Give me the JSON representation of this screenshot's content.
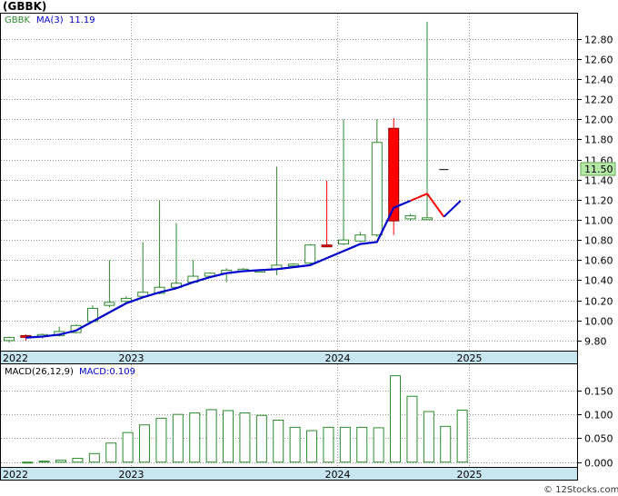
{
  "title": "(GBBK)",
  "watermark": "© 12Stocks.com",
  "price_panel": {
    "legend_symbol": "GBBK",
    "legend_ma_label": "MA(3)",
    "legend_ma_value": "11.19",
    "last_price_label": "11.50"
  },
  "macd_panel": {
    "legend_params": "MACD(26,12,9)",
    "legend_value": "MACD:0.109"
  },
  "x_axis_labels": [
    {
      "text": "2022",
      "index": 0
    },
    {
      "text": "2023",
      "index": 7.3
    },
    {
      "text": "2024",
      "index": 19.6
    },
    {
      "text": "2025",
      "index": 27.5
    }
  ],
  "colors": {
    "up_candle": "#2d8a2d",
    "down_candle": "#ff0000",
    "ma_line": "#0000cc",
    "ma_line_decline": "#ff0000",
    "axis_band": "#c8e6f0",
    "last_price_box": "#b5e8a6",
    "grid": "#9a9a9a"
  },
  "chart_data": [
    {
      "type": "candlestick",
      "title": "(GBBK)",
      "y_ticks": [
        9.8,
        10.0,
        10.2,
        10.4,
        10.6,
        10.8,
        11.0,
        11.2,
        11.4,
        11.6,
        11.8,
        12.0,
        12.2,
        12.4,
        12.6,
        12.8
      ],
      "ylim": [
        9.7,
        13.05
      ],
      "candles": [
        {
          "o": 9.8,
          "h": 9.84,
          "l": 9.78,
          "c": 9.83
        },
        {
          "o": 9.85,
          "h": 9.86,
          "l": 9.8,
          "c": 9.84
        },
        {
          "o": 9.84,
          "h": 9.87,
          "l": 9.82,
          "c": 9.86
        },
        {
          "o": 9.85,
          "h": 9.94,
          "l": 9.84,
          "c": 9.89
        },
        {
          "o": 9.88,
          "h": 9.96,
          "l": 9.87,
          "c": 9.95
        },
        {
          "o": 9.99,
          "h": 10.15,
          "l": 9.98,
          "c": 10.12
        },
        {
          "o": 10.15,
          "h": 10.6,
          "l": 10.13,
          "c": 10.18
        },
        {
          "o": 10.19,
          "h": 10.24,
          "l": 10.17,
          "c": 10.22
        },
        {
          "o": 10.24,
          "h": 10.78,
          "l": 10.23,
          "c": 10.28
        },
        {
          "o": 10.27,
          "h": 11.19,
          "l": 10.26,
          "c": 10.33
        },
        {
          "o": 10.33,
          "h": 10.97,
          "l": 10.31,
          "c": 10.37
        },
        {
          "o": 10.38,
          "h": 10.6,
          "l": 10.37,
          "c": 10.44
        },
        {
          "o": 10.44,
          "h": 10.48,
          "l": 10.43,
          "c": 10.47
        },
        {
          "o": 10.47,
          "h": 10.52,
          "l": 10.38,
          "c": 10.5
        },
        {
          "o": 10.51,
          "h": 10.52,
          "l": 10.5,
          "c": 10.51
        },
        {
          "o": 10.5,
          "h": 10.51,
          "l": 10.49,
          "c": 10.5
        },
        {
          "o": 10.51,
          "h": 11.53,
          "l": 10.45,
          "c": 10.55
        },
        {
          "o": 10.55,
          "h": 10.57,
          "l": 10.54,
          "c": 10.56
        },
        {
          "o": 10.57,
          "h": 10.76,
          "l": 10.56,
          "c": 10.75
        },
        {
          "o": 10.75,
          "h": 11.39,
          "l": 10.74,
          "c": 10.74
        },
        {
          "o": 10.76,
          "h": 12.0,
          "l": 10.75,
          "c": 10.8
        },
        {
          "o": 10.79,
          "h": 10.88,
          "l": 10.78,
          "c": 10.85
        },
        {
          "o": 10.85,
          "h": 12.0,
          "l": 10.83,
          "c": 11.77
        },
        {
          "o": 11.91,
          "h": 12.01,
          "l": 10.85,
          "c": 10.99
        },
        {
          "o": 11.01,
          "h": 11.06,
          "l": 10.99,
          "c": 11.04
        },
        {
          "o": 11.02,
          "h": 12.97,
          "l": 11.01,
          "c": 11.02
        },
        {
          "o": 11.5,
          "h": 11.5,
          "l": 11.5,
          "c": 11.5
        }
      ],
      "ma3": [
        null,
        9.83,
        9.84,
        9.86,
        9.9,
        9.99,
        10.08,
        10.17,
        10.23,
        10.28,
        10.32,
        10.38,
        10.43,
        10.47,
        10.49,
        10.5,
        10.51,
        10.53,
        10.55,
        10.62,
        10.69,
        10.76,
        10.78,
        11.12,
        11.19,
        11.26,
        11.03,
        11.19
      ],
      "ma3_decline_segment": [
        24,
        25,
        26
      ]
    },
    {
      "type": "bar",
      "title": "MACD(26,12,9)",
      "y_ticks": [
        0.0,
        0.05,
        0.1,
        0.15
      ],
      "ylim": [
        -0.01,
        0.205
      ],
      "values": [
        0.0,
        0.002,
        0.004,
        0.008,
        0.018,
        0.04,
        0.062,
        0.078,
        0.092,
        0.1,
        0.103,
        0.11,
        0.108,
        0.103,
        0.098,
        0.088,
        0.073,
        0.066,
        0.073,
        0.073,
        0.073,
        0.072,
        0.181,
        0.138,
        0.106,
        0.075,
        0.109
      ]
    }
  ]
}
